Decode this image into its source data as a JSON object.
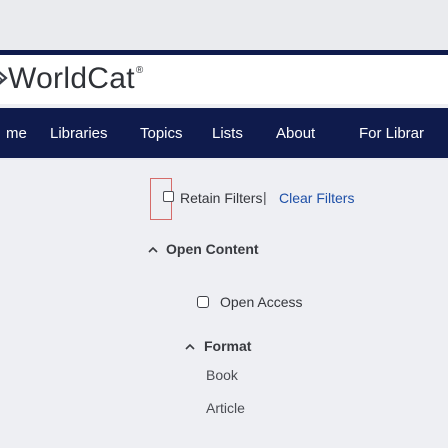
{
  "brand": {
    "name": "WorldCat",
    "mark": "®"
  },
  "nav": {
    "items": [
      "me",
      "Libraries",
      "Topics",
      "Lists",
      "About",
      "For Librar"
    ]
  },
  "filters": {
    "retain_label": "Retain Filters",
    "separator": "|",
    "clear_label": "Clear Filters"
  },
  "sections": {
    "open_content": {
      "title": "Open Content",
      "option": "Open Access"
    },
    "format": {
      "title": "Format",
      "options": [
        "Book",
        "Article"
      ]
    }
  },
  "colors": {
    "navy": "#0f1b4c",
    "link": "#1d4fa7",
    "focus_outline": "#d56b69",
    "background": "#eeeff3"
  },
  "icons": {
    "logo": "worldcat-globe-icon",
    "collapse": "chevron-up-icon",
    "checkbox": "checkbox-icon"
  }
}
